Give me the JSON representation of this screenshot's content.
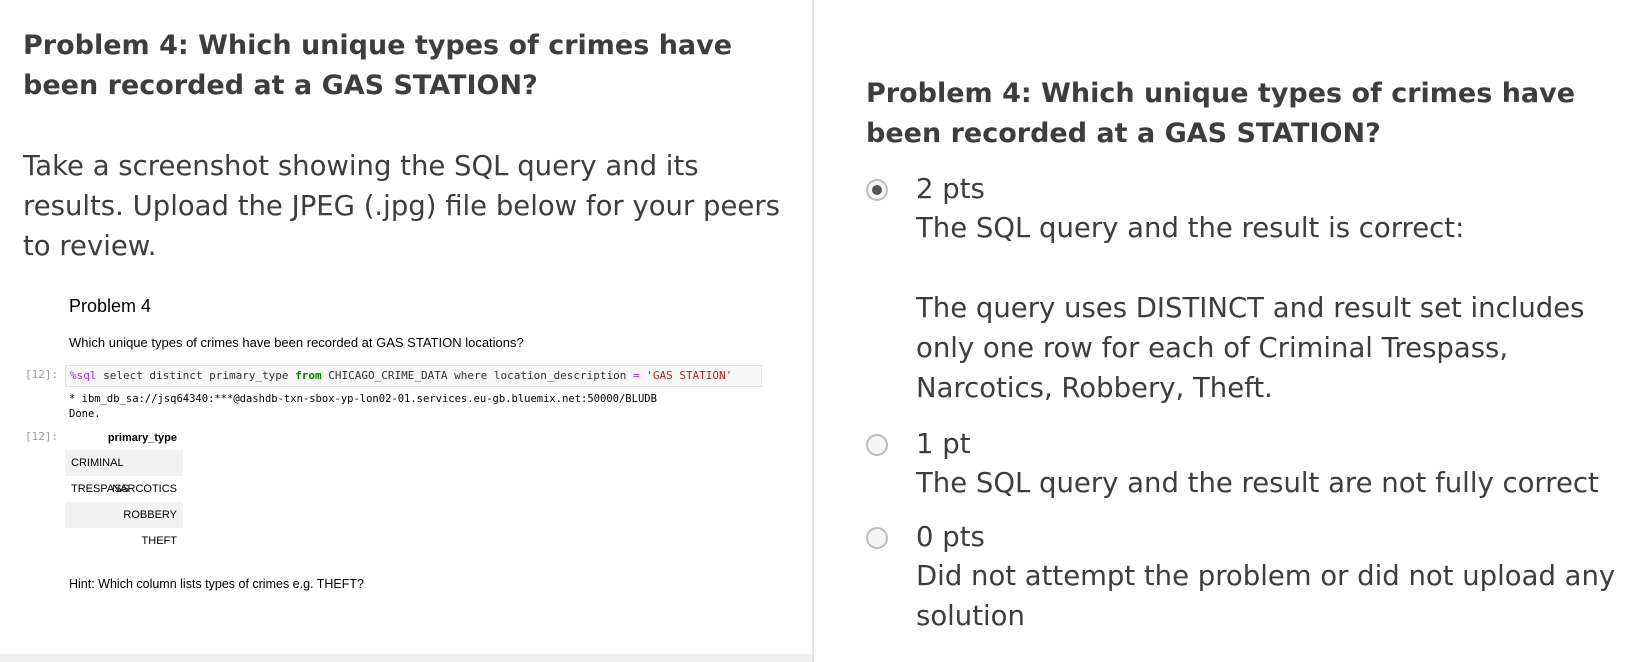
{
  "left": {
    "title": "Problem 4: Which unique types of crimes have been recorded at a GAS STATION?",
    "description": "Take a screenshot showing the SQL query and its results. Upload the JPEG (.jpg) file below for your peers to review.",
    "screenshot": {
      "heading": "Problem 4",
      "question": "Which unique types of crimes have been recorded at GAS STATION locations?",
      "input_prompt": "[12]:",
      "output_prompt": "[12]:",
      "query": {
        "magic": "%sql",
        "part1": " select distinct primary_type ",
        "kw_from": "from",
        "part2": " CHICAGO_CRIME_DATA where location_description ",
        "op": "=",
        "space": " ",
        "string": "'GAS STATION'"
      },
      "connection_line": " * ibm_db_sa://jsq64340:***@dashdb-txn-sbox-yp-lon02-01.services.eu-gb.bluemix.net:50000/BLUDB",
      "done_line": "Done.",
      "column_header": "primary_type",
      "rows": [
        "CRIMINAL TRESPASS",
        "NARCOTICS",
        "ROBBERY",
        "THEFT"
      ],
      "hint": "Hint: Which column lists types of crimes e.g. THEFT?"
    }
  },
  "right": {
    "title": "Problem 4: Which unique types of crimes have been recorded at a GAS STATION?",
    "options": [
      {
        "points": "2 pts",
        "selected": true,
        "desc_line1": "The SQL query and the result is correct:",
        "desc_line2": "The query uses DISTINCT and result set includes only one row for each of Criminal Trespass, Narcotics, Robbery, Theft."
      },
      {
        "points": "1 pt",
        "selected": false,
        "desc_line1": "The SQL query and the result are not fully correct"
      },
      {
        "points": "0 pts",
        "selected": false,
        "desc_line1": "Did not attempt the problem or did not upload any solution"
      }
    ]
  },
  "colors": {
    "text": "#3d3d3d",
    "divider": "#e4e4e4",
    "sql_keyword": "#008000",
    "sql_string": "#ba2121",
    "sql_magic": "#aa22ff"
  }
}
